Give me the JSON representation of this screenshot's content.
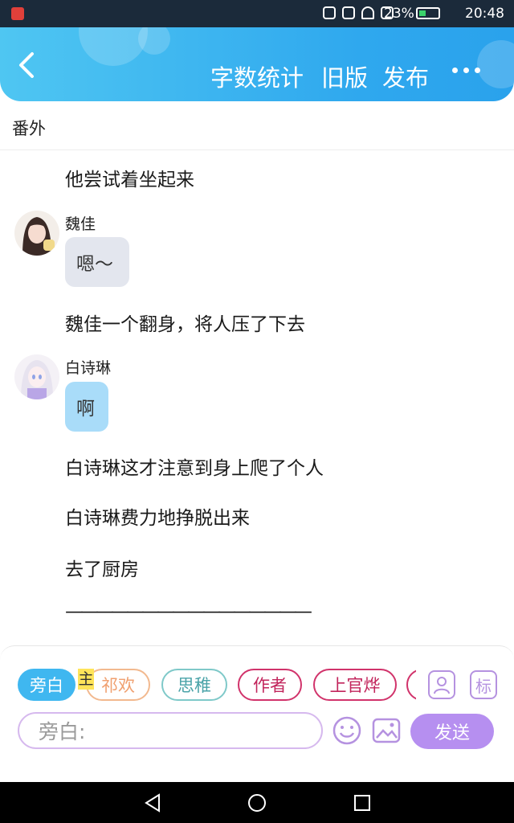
{
  "status_bar": {
    "battery": "23%",
    "time": "20:48"
  },
  "header": {
    "word_count": "字数统计",
    "old_version": "旧版",
    "publish": "发布"
  },
  "section_title": "番外",
  "messages": [
    {
      "type": "narration",
      "text": "他尝试着坐起来"
    },
    {
      "type": "dialogue",
      "name": "魏佳",
      "text": "嗯～"
    },
    {
      "type": "narration",
      "text": "魏佳一个翻身，将人压了下去"
    },
    {
      "type": "dialogue",
      "name": "白诗琳",
      "text": "啊"
    },
    {
      "type": "narration",
      "text": "白诗琳这才注意到身上爬了个人"
    },
    {
      "type": "narration",
      "text": "白诗琳费力地挣脱出来"
    },
    {
      "type": "narration",
      "text": "去了厨房"
    },
    {
      "type": "narration",
      "text": "————————————————"
    }
  ],
  "composer": {
    "chips": [
      "旁白",
      "祁欢",
      "思稚",
      "作者",
      "上官烨"
    ],
    "main_mark": "主",
    "tag_button": "标",
    "input_placeholder": "旁白:",
    "send": "发送"
  },
  "colors": {
    "header": "#2fa8ee",
    "chip_selected": "#3fb7f0",
    "send": "#b68ff0",
    "weijia_bubble": "#e3e6ee",
    "baishilin_bubble": "#a9dcf9"
  }
}
